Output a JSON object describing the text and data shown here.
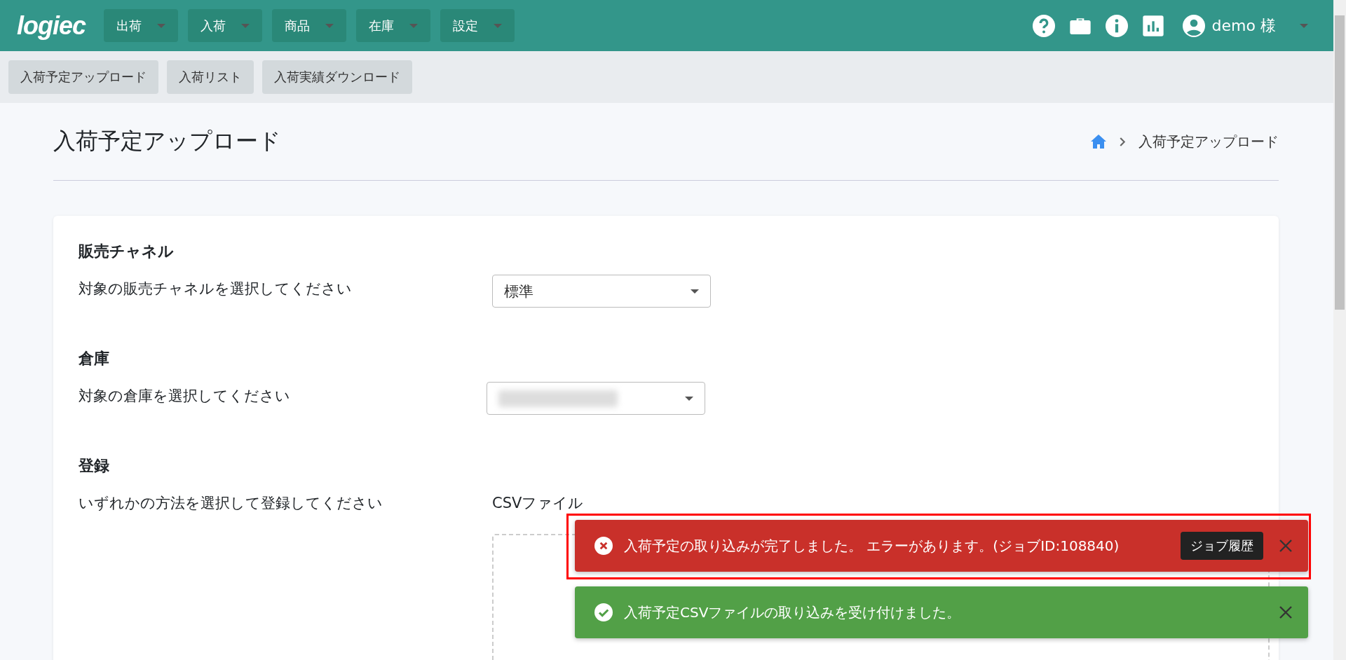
{
  "header": {
    "logo": "logiec",
    "menus": [
      {
        "label": "出荷"
      },
      {
        "label": "入荷"
      },
      {
        "label": "商品"
      },
      {
        "label": "在庫"
      },
      {
        "label": "設定"
      }
    ],
    "user": "demo 様"
  },
  "subnav": [
    {
      "label": "入荷予定アップロード"
    },
    {
      "label": "入荷リスト"
    },
    {
      "label": "入荷実績ダウンロード"
    }
  ],
  "page": {
    "title": "入荷予定アップロード",
    "breadcrumb": [
      "入荷予定アップロード"
    ]
  },
  "sections": [
    {
      "heading": "販売チャネル",
      "label": "対象の販売チャネルを選択してください",
      "kind": "select",
      "value": "標準",
      "blurred": false
    },
    {
      "heading": "倉庫",
      "label": "対象の倉庫を選択してください",
      "kind": "select",
      "blurred": true
    },
    {
      "heading": "登録",
      "label": "いずれかの方法を選択して登録してください",
      "kind": "upload",
      "text": "CSVファイル"
    }
  ],
  "toasts": [
    {
      "kind": "error",
      "message": "入荷予定の取り込みが完了しました。 エラーがあります。(ジョブID:108840)",
      "action": "ジョブ履歴",
      "highlighted": true
    },
    {
      "kind": "success",
      "message": "入荷予定CSVファイルの取り込みを受け付けました。",
      "highlighted": false
    }
  ]
}
